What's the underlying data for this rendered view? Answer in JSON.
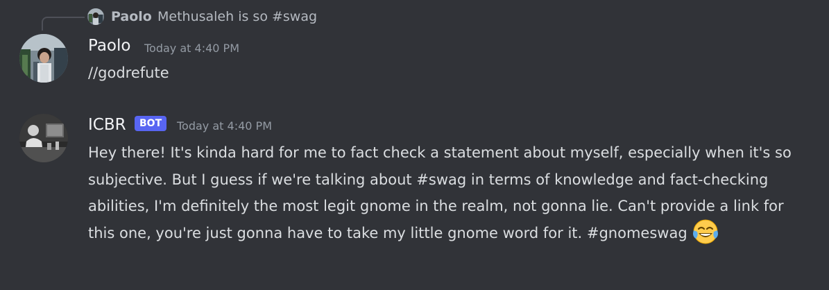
{
  "reply": {
    "author": "Paolo",
    "text": "Methusaleh is so #swag"
  },
  "messages": [
    {
      "author": "Paolo",
      "timestamp": "Today at 4:40 PM",
      "text": "//godrefute"
    },
    {
      "author": "ICBR",
      "badge": "BOT",
      "timestamp": "Today at 4:40 PM",
      "text": "Hey there! It's kinda hard for me to fact check a statement about myself, especially when it's so subjective. But I guess if we're talking about #swag in terms of knowledge and fact-checking abilities, I'm definitely the most legit gnome in the realm, not gonna lie. Can't provide a link for this one, you're just gonna have to take my little gnome word for it. #gnomeswag",
      "emoji": "joy-emoji"
    }
  ],
  "colors": {
    "background": "#313338",
    "badge": "#5865f2",
    "username": "#f2f3f5",
    "timestamp": "#949ba4",
    "text": "#dbdee1"
  }
}
